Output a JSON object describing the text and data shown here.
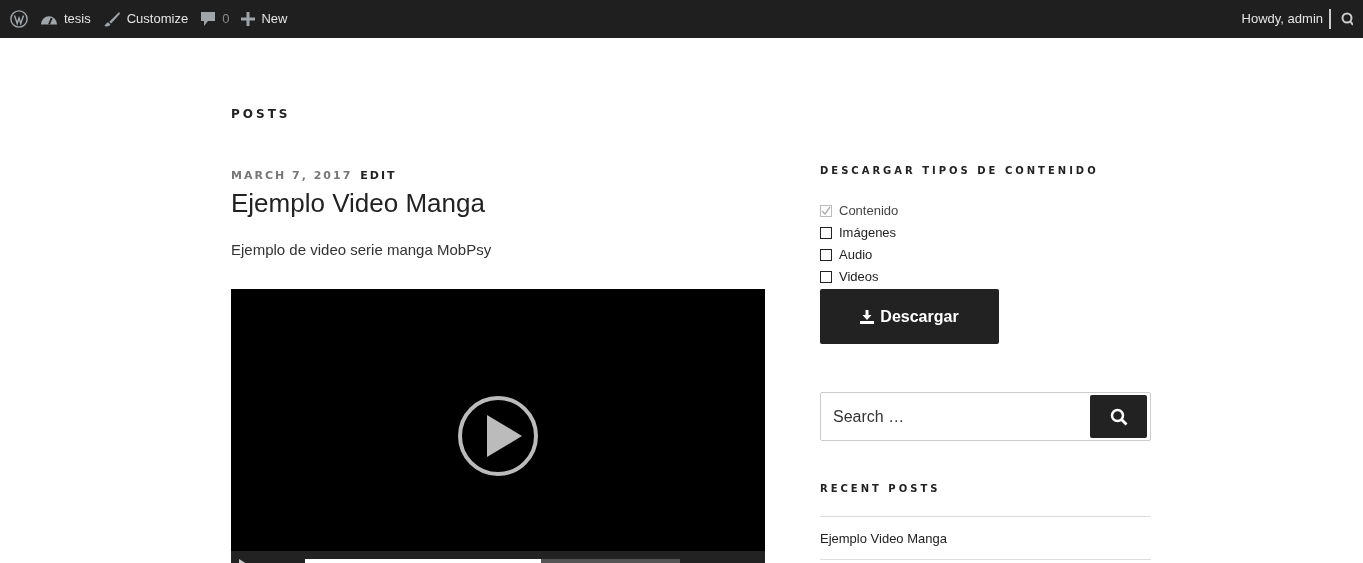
{
  "admin_bar": {
    "left": [
      {
        "kind": "logo"
      },
      {
        "kind": "dashboard",
        "label": "tesis"
      },
      {
        "kind": "customize",
        "label": "Customize"
      },
      {
        "kind": "comments",
        "label": "0"
      },
      {
        "kind": "new",
        "label": "New"
      }
    ],
    "greeting": "Howdy, admin"
  },
  "page_heading": "POSTS",
  "post": {
    "date": "MARCH 7, 2017",
    "edit": "EDIT",
    "title": "Ejemplo Video Manga",
    "excerpt": "Ejemplo de video serie manga MobPsy"
  },
  "download_widget": {
    "title": "DESCARGAR TIPOS DE CONTENIDO",
    "options": [
      {
        "label": "Contenido",
        "checked": true,
        "disabled": true
      },
      {
        "label": "Imágenes",
        "checked": false,
        "disabled": false
      },
      {
        "label": "Audio",
        "checked": false,
        "disabled": false
      },
      {
        "label": "Videos",
        "checked": false,
        "disabled": false
      }
    ],
    "button": "Descargar"
  },
  "search": {
    "placeholder": "Search …"
  },
  "recent_posts": {
    "title": "RECENT POSTS",
    "items": [
      "Ejemplo Video Manga"
    ]
  }
}
